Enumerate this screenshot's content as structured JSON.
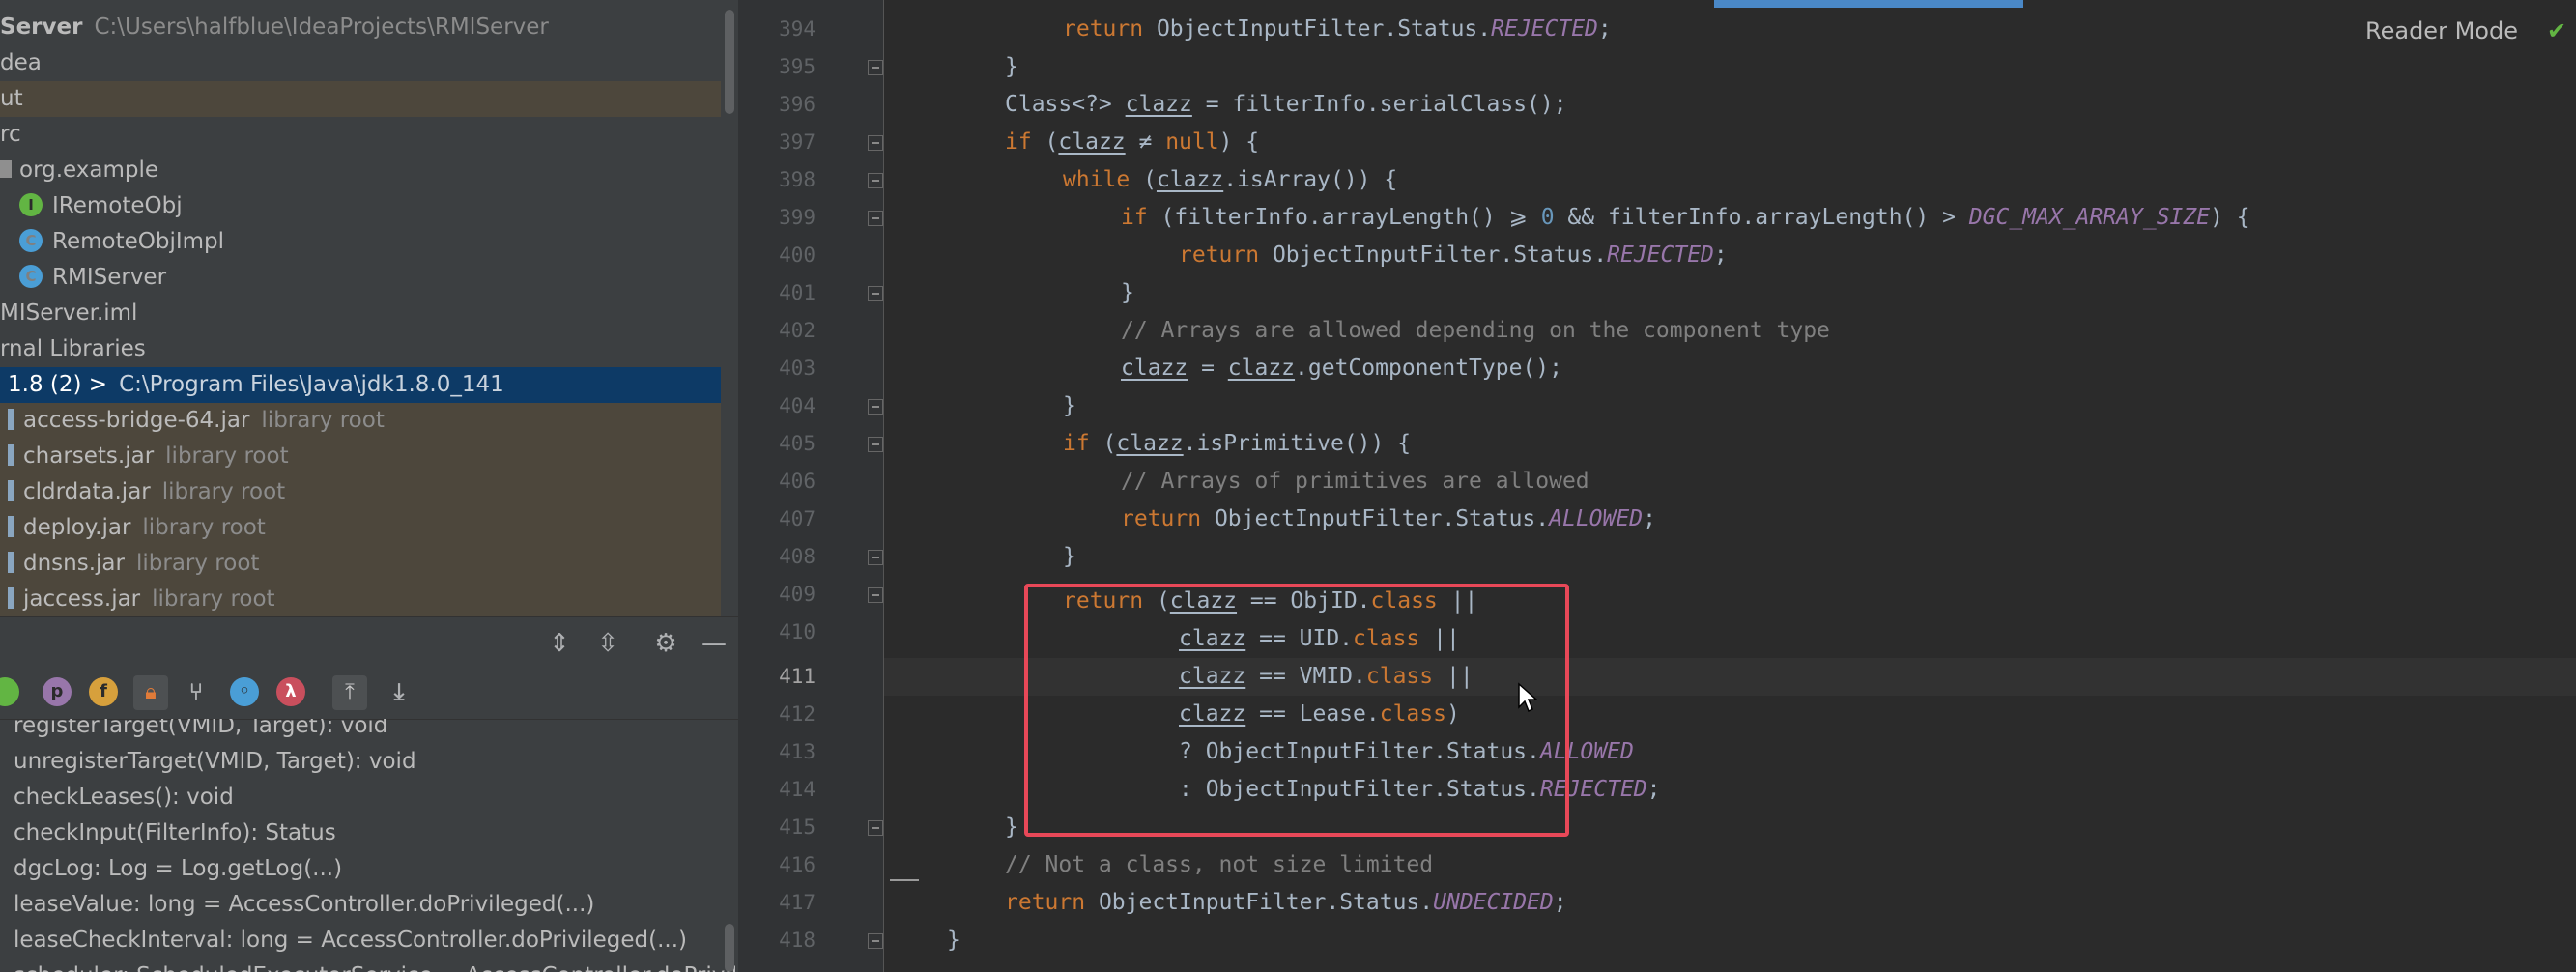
{
  "project_tree": {
    "rows": [
      {
        "text": "Server",
        "muted": "C:\\Users\\halfblue\\IdeaProjects\\RMIServer"
      },
      {
        "text": "dea"
      },
      {
        "text": "ut"
      },
      {
        "text": "rc"
      },
      {
        "text": "org.example"
      },
      {
        "text": "IRemoteObj",
        "icon": "I"
      },
      {
        "text": "RemoteObjImpl",
        "icon": "C"
      },
      {
        "text": "RMIServer",
        "icon": "C"
      },
      {
        "text": "MIServer.iml"
      },
      {
        "text": "rnal Libraries"
      },
      {
        "text": "1.8 (2) >",
        "muted": "C:\\Program Files\\Java\\jdk1.8.0_141"
      },
      {
        "text": "access-bridge-64.jar",
        "muted": "library root"
      },
      {
        "text": "charsets.jar",
        "muted": "library root"
      },
      {
        "text": "cldrdata.jar",
        "muted": "library root"
      },
      {
        "text": "deploy.jar",
        "muted": "library root"
      },
      {
        "text": "dnsns.jar",
        "muted": "library root"
      },
      {
        "text": "jaccess.jar",
        "muted": "library root"
      }
    ]
  },
  "structure_toolbar": {
    "icon_letters": [
      "p",
      "f",
      "λ"
    ]
  },
  "structure": {
    "rows": [
      "registerTarget(VMID, Target): void",
      "unregisterTarget(VMID, Target): void",
      "checkLeases(): void",
      "checkInput(FilterInfo): Status",
      "dgcLog: Log = Log.getLog(...)",
      "leaseValue: long = AccessController.doPrivileged(...)",
      "leaseCheckInterval: long = AccessController.doPrivileged(...)",
      "scheduler: ScheduledExecutorService = AccessController.doPrivileg"
    ]
  },
  "editor": {
    "reader_mode": "Reader Mode",
    "line_numbers": [
      "394",
      "395",
      "396",
      "397",
      "398",
      "399",
      "400",
      "401",
      "402",
      "403",
      "404",
      "405",
      "406",
      "407",
      "408",
      "409",
      "410",
      "411",
      "412",
      "413",
      "414",
      "415",
      "416",
      "417",
      "418"
    ],
    "current_line": "411",
    "code": {
      "l394": {
        "kw": "return",
        "t1": " ObjectInputFilter.Status.",
        "p": "REJECTED",
        "t2": ";"
      },
      "l395": "}",
      "l396": {
        "t1": "Class<?> ",
        "u": "clazz",
        "t2": " = filterInfo.serialClass();"
      },
      "l397": {
        "kw": "if",
        "t1": " (",
        "u": "clazz",
        "t2": " ≠ ",
        "kw2": "null",
        "t3": ") {"
      },
      "l398": {
        "kw": "while",
        "t1": " (",
        "u": "clazz",
        "t2": ".isArray()) {"
      },
      "l399": {
        "kw": "if",
        "t1": " (filterInfo.arrayLength() ⩾ ",
        "n": "0",
        "t2": " && filterInfo.arrayLength() > ",
        "p": "DGC_MAX_ARRAY_SIZE",
        "t3": ") {"
      },
      "l400": {
        "kw": "return",
        "t1": " ObjectInputFilter.Status.",
        "p": "REJECTED",
        "t2": ";"
      },
      "l401": "}",
      "l402": "// Arrays are allowed depending on the component type",
      "l403": {
        "u": "clazz",
        "t1": " = ",
        "u2": "clazz",
        "t2": ".getComponentType();"
      },
      "l404": "}",
      "l405": {
        "kw": "if",
        "t1": " (",
        "u": "clazz",
        "t2": ".isPrimitive()) {"
      },
      "l406": "// Arrays of primitives are allowed",
      "l407": {
        "kw": "return",
        "t1": " ObjectInputFilter.Status.",
        "p": "ALLOWED",
        "t2": ";"
      },
      "l408": "}",
      "l409": {
        "kw": "return",
        "t1": " (",
        "u": "clazz",
        "t2": " == ObjID.",
        "kw2": "class",
        "t3": " ||"
      },
      "l410": {
        "u": "clazz",
        "t2": " == UID.",
        "kw2": "class",
        "t3": " ||"
      },
      "l411": {
        "u": "clazz",
        "t2": " == VMID.",
        "kw2": "class",
        "t3": " ||"
      },
      "l412": {
        "u": "clazz",
        "t2": " == Lease.",
        "kw2": "class",
        "t3": ")"
      },
      "l413": {
        "t1": "? ObjectInputFilter.Status.",
        "p": "ALLOWED"
      },
      "l414": {
        "t1": ": ObjectInputFilter.Status.",
        "p": "REJECTED",
        "t2": ";"
      },
      "l415": "}",
      "l416": "// Not a class, not size limited",
      "l417": {
        "kw": "return",
        "t1": " ObjectInputFilter.Status.",
        "p": "UNDECIDED",
        "t2": ";"
      },
      "l418": "}"
    }
  }
}
